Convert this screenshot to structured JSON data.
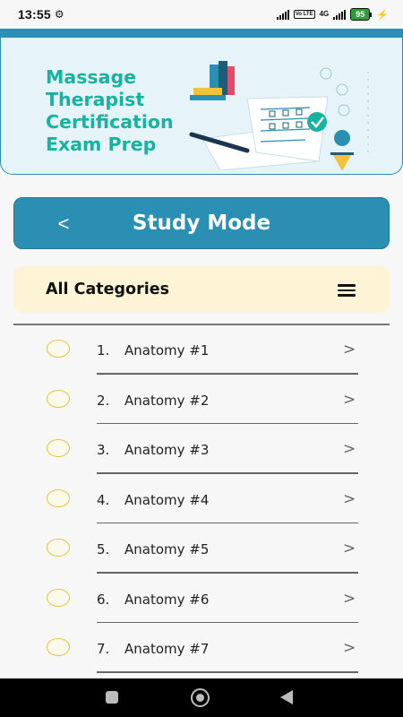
{
  "status_bar": {
    "time": "13:55",
    "gear_icon": "gear-icon",
    "network_tag": "Vo LTE",
    "network_type": "4G",
    "battery_level": "95",
    "battery_color": "#2f9e3a"
  },
  "banner": {
    "title": "Massage Therapist Certification Exam Prep",
    "title_color": "#17b3a1",
    "illustration_icon": "exam-paper-illustration"
  },
  "header": {
    "back_icon": "chevron-left-icon",
    "back_glyph": "<",
    "title": "Study Mode",
    "color": "#2b8fb3"
  },
  "category": {
    "label": "All Categories",
    "menu_icon": "hamburger-menu-icon",
    "background": "#fcf4d4"
  },
  "list": {
    "chevron_glyph": ">",
    "items": [
      {
        "number": "1.",
        "label": "Anatomy #1"
      },
      {
        "number": "2.",
        "label": "Anatomy #2"
      },
      {
        "number": "3.",
        "label": "Anatomy #3"
      },
      {
        "number": "4.",
        "label": "Anatomy #4"
      },
      {
        "number": "5.",
        "label": "Anatomy #5"
      },
      {
        "number": "6.",
        "label": "Anatomy #6"
      },
      {
        "number": "7.",
        "label": "Anatomy #7"
      }
    ]
  },
  "nav_bar": {
    "recents_icon": "square-recents-icon",
    "home_icon": "circle-home-icon",
    "back_icon": "triangle-back-icon"
  }
}
